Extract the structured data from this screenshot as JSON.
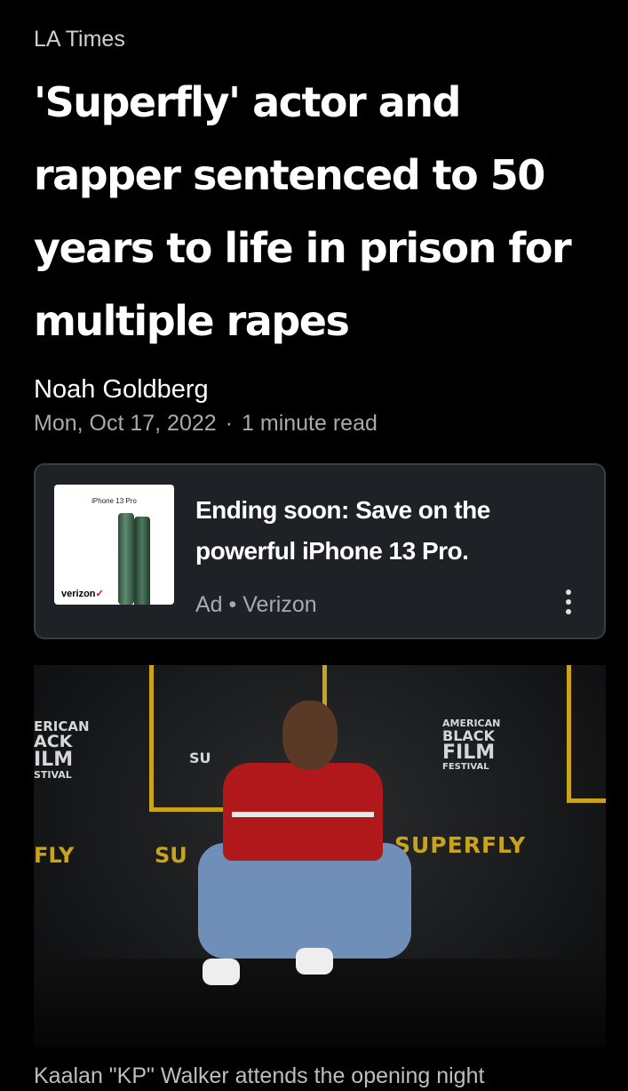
{
  "article": {
    "source": "LA Times",
    "headline": "'Superfly' actor and rapper sentenced to 50 years to life in prison for multiple rapes",
    "author": "Noah Goldberg",
    "date": "Mon, Oct 17, 2022",
    "separator": "·",
    "read_time": "1 minute read"
  },
  "ad": {
    "thumbnail_label": "iPhone 13 Pro",
    "thumbnail_brand": "verizon",
    "thumbnail_brand_mark": "✓",
    "title": "Ending soon: Save on the powerful  iPhone 13 Pro.",
    "label": "Ad",
    "bullet": "•",
    "advertiser": "Verizon",
    "menu_icon": "more-vertical-icon"
  },
  "photo": {
    "backdrop_left": [
      "ERICAN",
      "ACK",
      "ILM",
      "STIVAL"
    ],
    "backdrop_right": [
      "AMERICAN",
      "BLACK",
      "FILM",
      "FESTIVAL"
    ],
    "backdrop_small": "SU",
    "banner_left": "FLY",
    "banner_mid": "SU",
    "banner_right": "SUPERFLY"
  },
  "caption": "Kaalan \"KP\" Walker attends the opening night"
}
